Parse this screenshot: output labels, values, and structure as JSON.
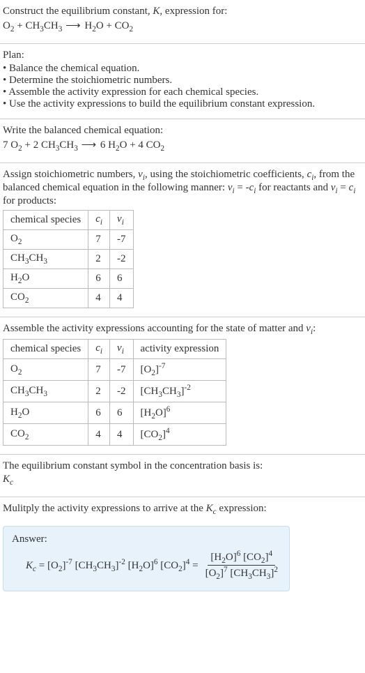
{
  "intro": {
    "line1": "Construct the equilibrium constant, ",
    "k": "K",
    "line1b": ", expression for:"
  },
  "unbalanced": {
    "lhs1": "O",
    "lhs1sub": "2",
    "plus": " + ",
    "lhs2a": "CH",
    "lhs2asub": "3",
    "lhs2b": "CH",
    "lhs2bsub": "3",
    "arrow": " ⟶ ",
    "rhs1a": "H",
    "rhs1asub": "2",
    "rhs1b": "O",
    "rhs2a": "CO",
    "rhs2asub": "2"
  },
  "plan_label": "Plan:",
  "plan": [
    "Balance the chemical equation.",
    "Determine the stoichiometric numbers.",
    "Assemble the activity expression for each chemical species.",
    "Use the activity expressions to build the equilibrium constant expression."
  ],
  "balanced_label": "Write the balanced chemical equation:",
  "balanced": {
    "c1": "7 ",
    "s1": "O",
    "s1sub": "2",
    "plus1": " + ",
    "c2": "2 ",
    "s2a": "CH",
    "s2asub": "3",
    "s2b": "CH",
    "s2bsub": "3",
    "arrow": " ⟶ ",
    "c3": "6 ",
    "s3a": "H",
    "s3asub": "2",
    "s3b": "O",
    "plus2": " + ",
    "c4": "4 ",
    "s4a": "CO",
    "s4asub": "2"
  },
  "assign_text": {
    "a": "Assign stoichiometric numbers, ",
    "nu": "ν",
    "i": "i",
    "b": ", using the stoichiometric coefficients, ",
    "c": "c",
    "d": ", from the balanced chemical equation in the following manner: ",
    "e": " = -",
    "f": " for reactants and ",
    "g": " = ",
    "h": " for products:"
  },
  "table1": {
    "h1": "chemical species",
    "h2c": "c",
    "h2i": "i",
    "h3n": "ν",
    "h3i": "i",
    "rows": [
      {
        "sp_a": "O",
        "sp_asub": "2",
        "sp_b": "",
        "sp_bsub": "",
        "sp_c": "",
        "sp_csub": "",
        "c": "7",
        "nu": "-7"
      },
      {
        "sp_a": "CH",
        "sp_asub": "3",
        "sp_b": "CH",
        "sp_bsub": "3",
        "sp_c": "",
        "sp_csub": "",
        "c": "2",
        "nu": "-2"
      },
      {
        "sp_a": "H",
        "sp_asub": "2",
        "sp_b": "O",
        "sp_bsub": "",
        "sp_c": "",
        "sp_csub": "",
        "c": "6",
        "nu": "6"
      },
      {
        "sp_a": "CO",
        "sp_asub": "2",
        "sp_b": "",
        "sp_bsub": "",
        "sp_c": "",
        "sp_csub": "",
        "c": "4",
        "nu": "4"
      }
    ]
  },
  "assemble_text": {
    "a": "Assemble the activity expressions accounting for the state of matter and ",
    "nu": "ν",
    "i": "i",
    "colon": ":"
  },
  "table2": {
    "h1": "chemical species",
    "h2c": "c",
    "h2i": "i",
    "h3n": "ν",
    "h3i": "i",
    "h4": "activity expression",
    "rows": [
      {
        "sp_a": "O",
        "sp_asub": "2",
        "sp_b": "",
        "sp_bsub": "",
        "c": "7",
        "nu": "-7",
        "act_a": "[O",
        "act_asub": "2",
        "act_b": "]",
        "act_sup": "-7",
        "act_c": "",
        "act_csub": "",
        "act_d": ""
      },
      {
        "sp_a": "CH",
        "sp_asub": "3",
        "sp_b": "CH",
        "sp_bsub": "3",
        "c": "2",
        "nu": "-2",
        "act_a": "[CH",
        "act_asub": "3",
        "act_b": "CH",
        "act_c": "",
        "act_csub": "3",
        "act_d": "]",
        "act_sup": "-2"
      },
      {
        "sp_a": "H",
        "sp_asub": "2",
        "sp_b": "O",
        "sp_bsub": "",
        "c": "6",
        "nu": "6",
        "act_a": "[H",
        "act_asub": "2",
        "act_b": "O]",
        "act_sup": "6",
        "act_c": "",
        "act_csub": "",
        "act_d": ""
      },
      {
        "sp_a": "CO",
        "sp_asub": "2",
        "sp_b": "",
        "sp_bsub": "",
        "c": "4",
        "nu": "4",
        "act_a": "[CO",
        "act_asub": "2",
        "act_b": "]",
        "act_sup": "4",
        "act_c": "",
        "act_csub": "",
        "act_d": ""
      }
    ]
  },
  "kbasis": {
    "line": "The equilibrium constant symbol in the concentration basis is:",
    "K": "K",
    "c": "c"
  },
  "multiply": {
    "a": "Mulitply the activity expressions to arrive at the ",
    "K": "K",
    "c": "c",
    "b": " expression:"
  },
  "answer": {
    "label": "Answer:",
    "K": "K",
    "c": "c",
    "eq": " = ",
    "t1a": "[O",
    "t1sub": "2",
    "t1b": "]",
    "t1sup": "-7",
    "t2a": " [CH",
    "t2sub": "3",
    "t2b": "CH",
    "t2sub2": "3",
    "t2c": "]",
    "t2sup": "-2",
    "t3a": " [H",
    "t3sub": "2",
    "t3b": "O]",
    "t3sup": "6",
    "t4a": " [CO",
    "t4sub": "2",
    "t4b": "]",
    "t4sup": "4",
    "eq2": " = ",
    "num": {
      "a": "[H",
      "asub": "2",
      "b": "O]",
      "bsup": "6",
      "c": " [CO",
      "csub": "2",
      "d": "]",
      "dsup": "4"
    },
    "den": {
      "a": "[O",
      "asub": "2",
      "b": "]",
      "bsup": "7",
      "c": " [CH",
      "csub": "3",
      "d": "CH",
      "dsub": "3",
      "e": "]",
      "esup": "2"
    }
  }
}
